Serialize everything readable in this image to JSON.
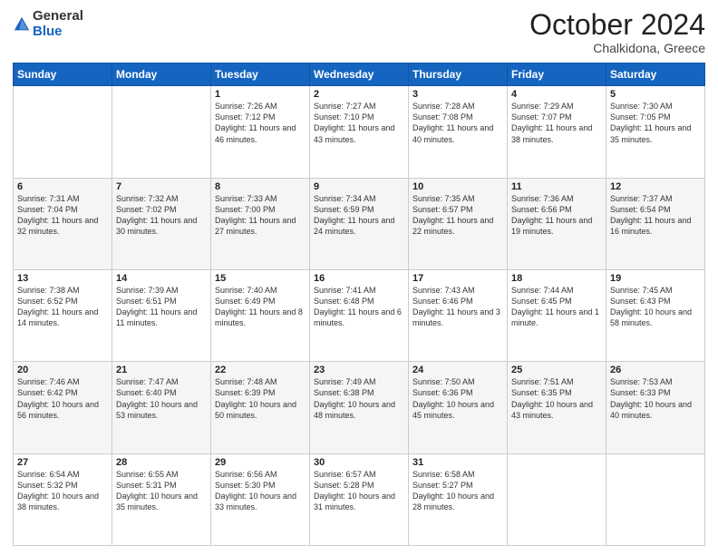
{
  "header": {
    "logo_general": "General",
    "logo_blue": "Blue",
    "month_title": "October 2024",
    "subtitle": "Chalkidona, Greece"
  },
  "weekdays": [
    "Sunday",
    "Monday",
    "Tuesday",
    "Wednesday",
    "Thursday",
    "Friday",
    "Saturday"
  ],
  "rows": [
    [
      {
        "day": "",
        "info": ""
      },
      {
        "day": "",
        "info": ""
      },
      {
        "day": "1",
        "info": "Sunrise: 7:26 AM\nSunset: 7:12 PM\nDaylight: 11 hours and 46 minutes."
      },
      {
        "day": "2",
        "info": "Sunrise: 7:27 AM\nSunset: 7:10 PM\nDaylight: 11 hours and 43 minutes."
      },
      {
        "day": "3",
        "info": "Sunrise: 7:28 AM\nSunset: 7:08 PM\nDaylight: 11 hours and 40 minutes."
      },
      {
        "day": "4",
        "info": "Sunrise: 7:29 AM\nSunset: 7:07 PM\nDaylight: 11 hours and 38 minutes."
      },
      {
        "day": "5",
        "info": "Sunrise: 7:30 AM\nSunset: 7:05 PM\nDaylight: 11 hours and 35 minutes."
      }
    ],
    [
      {
        "day": "6",
        "info": "Sunrise: 7:31 AM\nSunset: 7:04 PM\nDaylight: 11 hours and 32 minutes."
      },
      {
        "day": "7",
        "info": "Sunrise: 7:32 AM\nSunset: 7:02 PM\nDaylight: 11 hours and 30 minutes."
      },
      {
        "day": "8",
        "info": "Sunrise: 7:33 AM\nSunset: 7:00 PM\nDaylight: 11 hours and 27 minutes."
      },
      {
        "day": "9",
        "info": "Sunrise: 7:34 AM\nSunset: 6:59 PM\nDaylight: 11 hours and 24 minutes."
      },
      {
        "day": "10",
        "info": "Sunrise: 7:35 AM\nSunset: 6:57 PM\nDaylight: 11 hours and 22 minutes."
      },
      {
        "day": "11",
        "info": "Sunrise: 7:36 AM\nSunset: 6:56 PM\nDaylight: 11 hours and 19 minutes."
      },
      {
        "day": "12",
        "info": "Sunrise: 7:37 AM\nSunset: 6:54 PM\nDaylight: 11 hours and 16 minutes."
      }
    ],
    [
      {
        "day": "13",
        "info": "Sunrise: 7:38 AM\nSunset: 6:52 PM\nDaylight: 11 hours and 14 minutes."
      },
      {
        "day": "14",
        "info": "Sunrise: 7:39 AM\nSunset: 6:51 PM\nDaylight: 11 hours and 11 minutes."
      },
      {
        "day": "15",
        "info": "Sunrise: 7:40 AM\nSunset: 6:49 PM\nDaylight: 11 hours and 8 minutes."
      },
      {
        "day": "16",
        "info": "Sunrise: 7:41 AM\nSunset: 6:48 PM\nDaylight: 11 hours and 6 minutes."
      },
      {
        "day": "17",
        "info": "Sunrise: 7:43 AM\nSunset: 6:46 PM\nDaylight: 11 hours and 3 minutes."
      },
      {
        "day": "18",
        "info": "Sunrise: 7:44 AM\nSunset: 6:45 PM\nDaylight: 11 hours and 1 minute."
      },
      {
        "day": "19",
        "info": "Sunrise: 7:45 AM\nSunset: 6:43 PM\nDaylight: 10 hours and 58 minutes."
      }
    ],
    [
      {
        "day": "20",
        "info": "Sunrise: 7:46 AM\nSunset: 6:42 PM\nDaylight: 10 hours and 56 minutes."
      },
      {
        "day": "21",
        "info": "Sunrise: 7:47 AM\nSunset: 6:40 PM\nDaylight: 10 hours and 53 minutes."
      },
      {
        "day": "22",
        "info": "Sunrise: 7:48 AM\nSunset: 6:39 PM\nDaylight: 10 hours and 50 minutes."
      },
      {
        "day": "23",
        "info": "Sunrise: 7:49 AM\nSunset: 6:38 PM\nDaylight: 10 hours and 48 minutes."
      },
      {
        "day": "24",
        "info": "Sunrise: 7:50 AM\nSunset: 6:36 PM\nDaylight: 10 hours and 45 minutes."
      },
      {
        "day": "25",
        "info": "Sunrise: 7:51 AM\nSunset: 6:35 PM\nDaylight: 10 hours and 43 minutes."
      },
      {
        "day": "26",
        "info": "Sunrise: 7:53 AM\nSunset: 6:33 PM\nDaylight: 10 hours and 40 minutes."
      }
    ],
    [
      {
        "day": "27",
        "info": "Sunrise: 6:54 AM\nSunset: 5:32 PM\nDaylight: 10 hours and 38 minutes."
      },
      {
        "day": "28",
        "info": "Sunrise: 6:55 AM\nSunset: 5:31 PM\nDaylight: 10 hours and 35 minutes."
      },
      {
        "day": "29",
        "info": "Sunrise: 6:56 AM\nSunset: 5:30 PM\nDaylight: 10 hours and 33 minutes."
      },
      {
        "day": "30",
        "info": "Sunrise: 6:57 AM\nSunset: 5:28 PM\nDaylight: 10 hours and 31 minutes."
      },
      {
        "day": "31",
        "info": "Sunrise: 6:58 AM\nSunset: 5:27 PM\nDaylight: 10 hours and 28 minutes."
      },
      {
        "day": "",
        "info": ""
      },
      {
        "day": "",
        "info": ""
      }
    ]
  ]
}
